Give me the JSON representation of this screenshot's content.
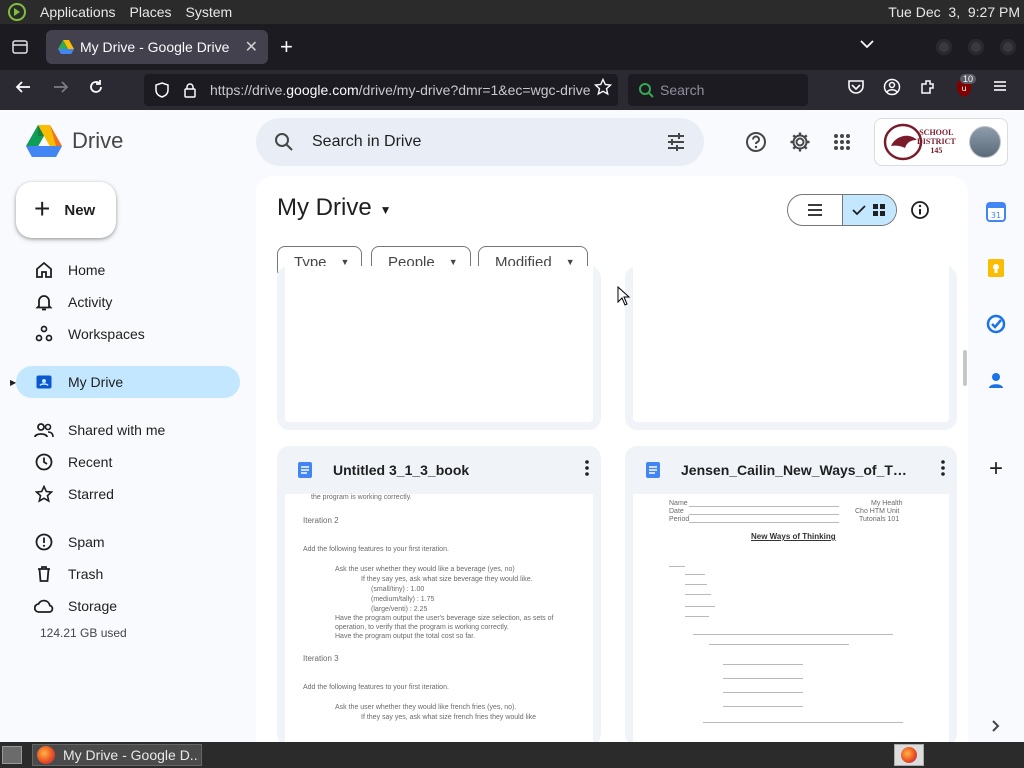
{
  "os_panel": {
    "menu": [
      "Applications",
      "Places",
      "System"
    ],
    "clock": "Tue Dec  3,  9:27 PM"
  },
  "browser": {
    "tab_title": "My Drive - Google Drive",
    "url_prefix": "https://drive.",
    "url_host": "google.com",
    "url_rest": "/drive/my-drive?dmr=1&ec=wgc-drive",
    "search_placeholder": "Search",
    "extension_badge": "10"
  },
  "drive": {
    "product_name": "Drive",
    "search_placeholder": "Search in Drive",
    "account_logo_text": [
      "SCHOOL",
      "DISTRICT",
      "145"
    ],
    "new_button": "New",
    "nav": [
      {
        "label": "Home",
        "icon": "home-icon"
      },
      {
        "label": "Activity",
        "icon": "bell-icon"
      },
      {
        "label": "Workspaces",
        "icon": "workspaces-icon"
      },
      {
        "label": "My Drive",
        "icon": "my-drive-icon",
        "active": true
      },
      {
        "label": "Shared with me",
        "icon": "people-icon"
      },
      {
        "label": "Recent",
        "icon": "clock-icon"
      },
      {
        "label": "Starred",
        "icon": "star-icon"
      },
      {
        "label": "Spam",
        "icon": "spam-icon"
      },
      {
        "label": "Trash",
        "icon": "trash-icon"
      },
      {
        "label": "Storage",
        "icon": "cloud-icon"
      }
    ],
    "storage_used": "124.21 GB used",
    "page_title": "My Drive",
    "filters": [
      "Type",
      "People",
      "Modified"
    ],
    "view_mode": "grid",
    "files": [
      {
        "name": "Untitled 3_1_3_book",
        "type": "doc"
      },
      {
        "name": "Jensen_Cailin_New_Ways_of_Thinking",
        "type": "doc"
      }
    ],
    "preview_doc1": {
      "top_text": "the program is working correctly.",
      "iteration2": "Iteration 2",
      "add_features": "Add the following features to your first iteration.",
      "ask_beverage": "Ask the user whether they would like a beverage (yes, no)",
      "if_yes": "If they say yes, ask what size beverage they would like.",
      "small": "(small/tiny) : 1.00",
      "medium": "(medium/tally) : 1.75",
      "large": "(large/venti) : 2.25",
      "have_output": "Have the program output the user's beverage size selection, as sets of",
      "operation": "operation, to verify that the program is working correctly.",
      "have_total": "Have the program output the total cost so far.",
      "iteration3": "Iteration 3",
      "add_features2": "Add the following features to your first iteration.",
      "ask_fries": "Ask the user whether they would like french fries (yes, no).",
      "if_yes2": "If they say yes, ask what size french fries they would like"
    },
    "preview_doc2": {
      "title": "New Ways of Thinking",
      "fields": [
        "Name",
        "Date",
        "Period"
      ],
      "right_fields": [
        "My Health",
        "Cho HTM Unit",
        "Tutorials 101"
      ]
    }
  }
}
